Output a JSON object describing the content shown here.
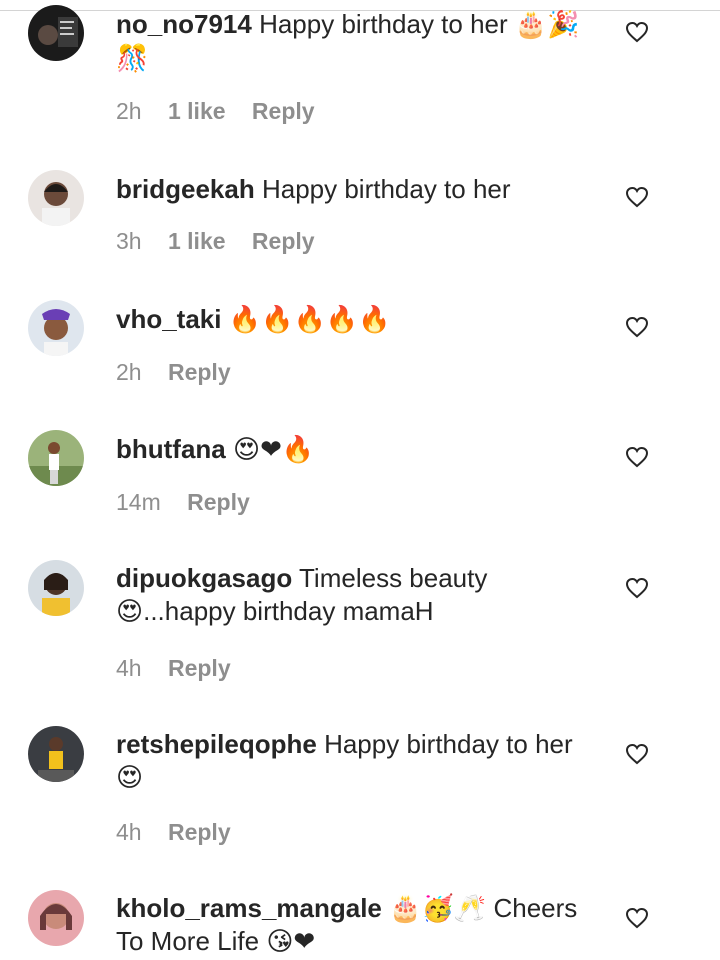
{
  "comments": [
    {
      "username": "no_no7914",
      "text": "Happy birthday to her",
      "emoji": "🎂🎉🎊",
      "time": "2h",
      "likes": "1 like",
      "reply": "Reply"
    },
    {
      "username": "bridgeekah",
      "text": "Happy birthday to her",
      "emoji": "",
      "time": "3h",
      "likes": "1 like",
      "reply": "Reply"
    },
    {
      "username": "vho_taki",
      "text": "",
      "emoji": "🔥🔥🔥🔥🔥",
      "time": "2h",
      "likes": "",
      "reply": "Reply"
    },
    {
      "username": "bhutfana",
      "text": "",
      "emoji": "😍❤🔥",
      "time": "14m",
      "likes": "",
      "reply": "Reply"
    },
    {
      "username": "dipuokgasago",
      "text": "Timeless beauty",
      "emoji": "😍",
      "text2": "...happy birthday mamaH",
      "time": "4h",
      "likes": "",
      "reply": "Reply"
    },
    {
      "username": "retshepileqophe",
      "text": "Happy birthday to her",
      "emoji": "😍",
      "time": "4h",
      "likes": "",
      "reply": "Reply"
    },
    {
      "username": "kholo_rams_mangale",
      "text": "🎂🥳🥂 Cheers To More Life",
      "emoji": "😘❤",
      "time": "",
      "likes": "",
      "reply": ""
    }
  ],
  "icons": {
    "heart": "heart-outline-icon"
  },
  "colors": {
    "meta": "#8e8e8e",
    "text": "#262626"
  }
}
